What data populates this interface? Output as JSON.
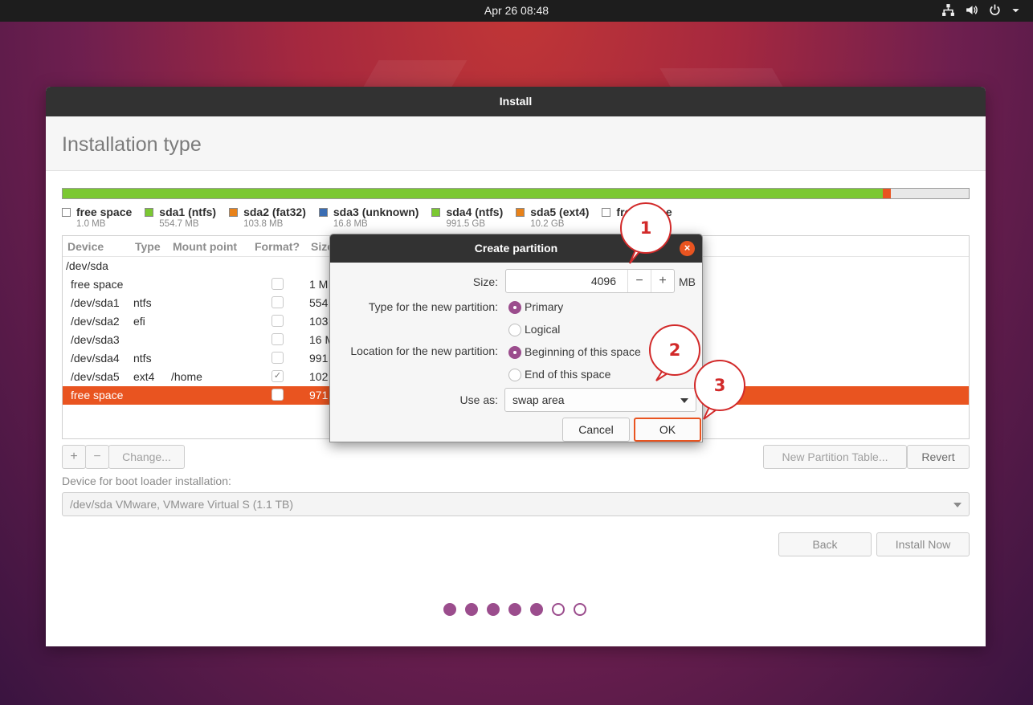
{
  "topbar": {
    "clock": "Apr 26  08:48",
    "icons": [
      "network-icon",
      "volume-icon",
      "power-icon",
      "chevron-down-icon"
    ]
  },
  "window": {
    "title": "Install",
    "page_title": "Installation type"
  },
  "disk_bar": {
    "segments": [
      {
        "color": "#7bc832",
        "fraction": 0.905
      },
      {
        "color": "#e95420",
        "fraction": 0.009
      },
      {
        "color": "#e8e8e8",
        "fraction": 0.086
      }
    ]
  },
  "legend": [
    {
      "name": "free space",
      "size": "1.0 MB",
      "color": "#ffffff"
    },
    {
      "name": "sda1 (ntfs)",
      "size": "554.7 MB",
      "color": "#7bc832"
    },
    {
      "name": "sda2 (fat32)",
      "size": "103.8 MB",
      "color": "#e8821a"
    },
    {
      "name": "sda3 (unknown)",
      "size": "16.8 MB",
      "color": "#3a6db3"
    },
    {
      "name": "sda4 (ntfs)",
      "size": "991.5 GB",
      "color": "#7bc832"
    },
    {
      "name": "sda5 (ext4)",
      "size": "10.2 GB",
      "color": "#e8821a"
    },
    {
      "name": "free space",
      "size": "",
      "color": "#ffffff"
    }
  ],
  "table": {
    "headers": {
      "device": "Device",
      "type": "Type",
      "mount": "Mount point",
      "format": "Format?",
      "size": "Size"
    },
    "rows": [
      {
        "device": "/dev/sda",
        "type": "",
        "mount": "",
        "format": null,
        "size": "",
        "selected": false,
        "indent": false
      },
      {
        "device": "free space",
        "type": "",
        "mount": "",
        "format": false,
        "size": "1 M",
        "selected": false,
        "indent": true
      },
      {
        "device": "/dev/sda1",
        "type": "ntfs",
        "mount": "",
        "format": false,
        "size": "554",
        "selected": false,
        "indent": true
      },
      {
        "device": "/dev/sda2",
        "type": "efi",
        "mount": "",
        "format": false,
        "size": "103",
        "selected": false,
        "indent": true
      },
      {
        "device": "/dev/sda3",
        "type": "",
        "mount": "",
        "format": false,
        "size": "16 M",
        "selected": false,
        "indent": true
      },
      {
        "device": "/dev/sda4",
        "type": "ntfs",
        "mount": "",
        "format": false,
        "size": "991",
        "selected": false,
        "indent": true
      },
      {
        "device": "/dev/sda5",
        "type": "ext4",
        "mount": "/home",
        "format": true,
        "size": "102",
        "selected": false,
        "indent": true
      },
      {
        "device": "free space",
        "type": "",
        "mount": "",
        "format": false,
        "size": "971",
        "selected": true,
        "indent": true
      }
    ]
  },
  "toolbar": {
    "add": "+",
    "remove": "−",
    "change": "Change...",
    "new_table": "New Partition Table...",
    "revert": "Revert"
  },
  "boot": {
    "label": "Device for boot loader installation:",
    "value": "/dev/sda    VMware, VMware Virtual S (1.1 TB)"
  },
  "nav": {
    "back": "Back",
    "install_now": "Install Now"
  },
  "progress": {
    "total_steps": 7,
    "completed_steps": 5
  },
  "dialog": {
    "title": "Create partition",
    "size_label": "Size:",
    "size_value": "4096",
    "size_unit": "MB",
    "decrement": "−",
    "increment": "+",
    "type_label": "Type for the new partition:",
    "type_primary": "Primary",
    "type_logical": "Logical",
    "location_label": "Location for the new partition:",
    "location_beginning": "Beginning of this space",
    "location_end": "End of this space",
    "useas_label": "Use as:",
    "useas_value": "swap area",
    "cancel": "Cancel",
    "ok": "OK",
    "close": "×"
  },
  "callouts": [
    "1",
    "2",
    "3"
  ],
  "colors": {
    "accent": "#e95420",
    "radio": "#9b4d8d",
    "callout": "#d22a2a"
  }
}
